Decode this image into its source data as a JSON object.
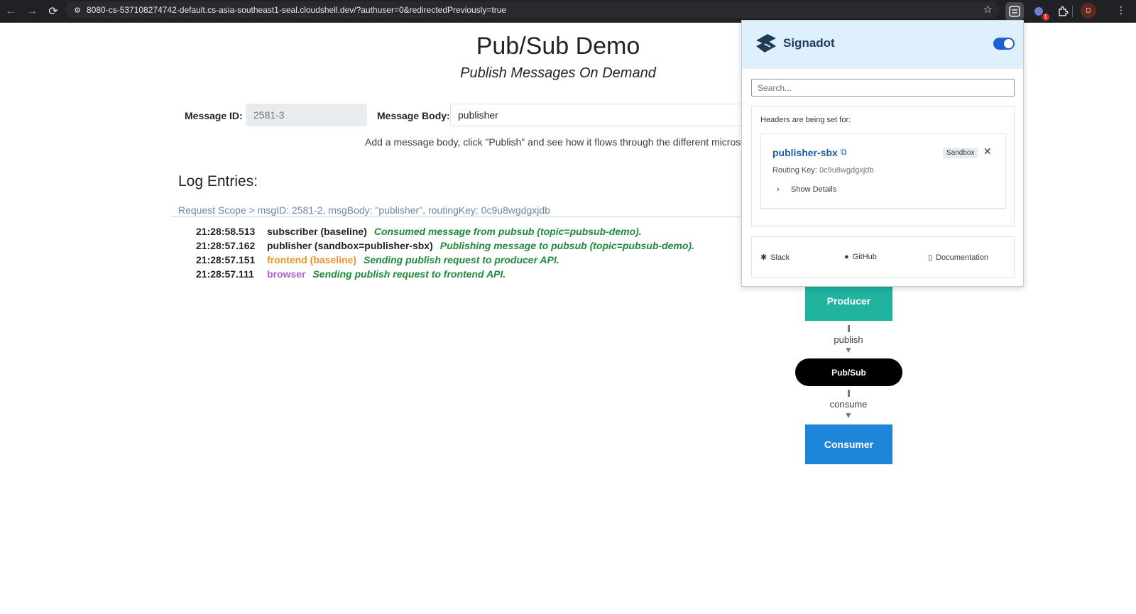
{
  "browser": {
    "back_icon": "←",
    "forward_icon": "→",
    "reload_icon": "⟳",
    "site_icon": "⚙",
    "url": "8080-cs-537108274742-default.cs-asia-southeast1-seal.cloudshell.dev/?authuser=0&redirectedPreviously=true",
    "star_icon": "☆",
    "extension_badge": "1",
    "profile_initial": "D",
    "menu_icon": "⋮"
  },
  "page": {
    "title": "Pub/Sub Demo",
    "subtitle": "Publish Messages On Demand",
    "message_id_label": "Message ID:",
    "message_id_value": "2581-3",
    "message_body_label": "Message Body:",
    "message_body_value": "publisher",
    "hint": "Add a message body, click \"Publish\" and see how it flows through the different microservic",
    "log_title": "Log Entries:",
    "request_scope": "Request Scope > msgID: 2581-2, msgBody: \"publisher\", routingKey: 0c9u8wgdgxjdb",
    "logs": [
      {
        "ts": "21:28:58.513",
        "service": "subscriber (baseline)",
        "message": "Consumed message from pubsub (topic=pubsub-demo).",
        "service_color": "#212529"
      },
      {
        "ts": "21:28:57.162",
        "service": "publisher (sandbox=publisher-sbx)",
        "message": "Publishing message to pubsub (topic=pubsub-demo).",
        "service_color": "#212529"
      },
      {
        "ts": "21:28:57.151",
        "service": "frontend (baseline)",
        "message": "Sending publish request to producer API.",
        "service_color": "#f0922b"
      },
      {
        "ts": "21:28:57.111",
        "service": "browser",
        "message": "Sending publish request to frontend API.",
        "service_color": "#b05fd1"
      }
    ]
  },
  "diagram": {
    "producer": "Producer",
    "publish": "publish",
    "pubsub": "Pub/Sub",
    "consume": "consume",
    "consumer": "Consumer"
  },
  "popup": {
    "brand": "Signadot",
    "search_placeholder": "Search...",
    "headers_title": "Headers are being set for:",
    "sandbox_name": "publisher-sbx",
    "external_link_icon": "⧉",
    "sandbox_badge": "Sandbox",
    "close_icon": "✕",
    "routing_key_label": "Routing Key:",
    "routing_key_value": "0c9u8wgdgxjdb",
    "show_details": "Show Details",
    "chevron_icon": "›",
    "slack": "Slack",
    "github": "GitHub",
    "documentation": "Documentation",
    "slack_icon": "✱",
    "github_icon": "●",
    "doc_icon": "▯"
  },
  "colors": {
    "producer": "#1fb3a0",
    "consumer": "#1d86d9",
    "log_message": "#1e8a3a",
    "brand_toggle": "#1a5fd6"
  }
}
